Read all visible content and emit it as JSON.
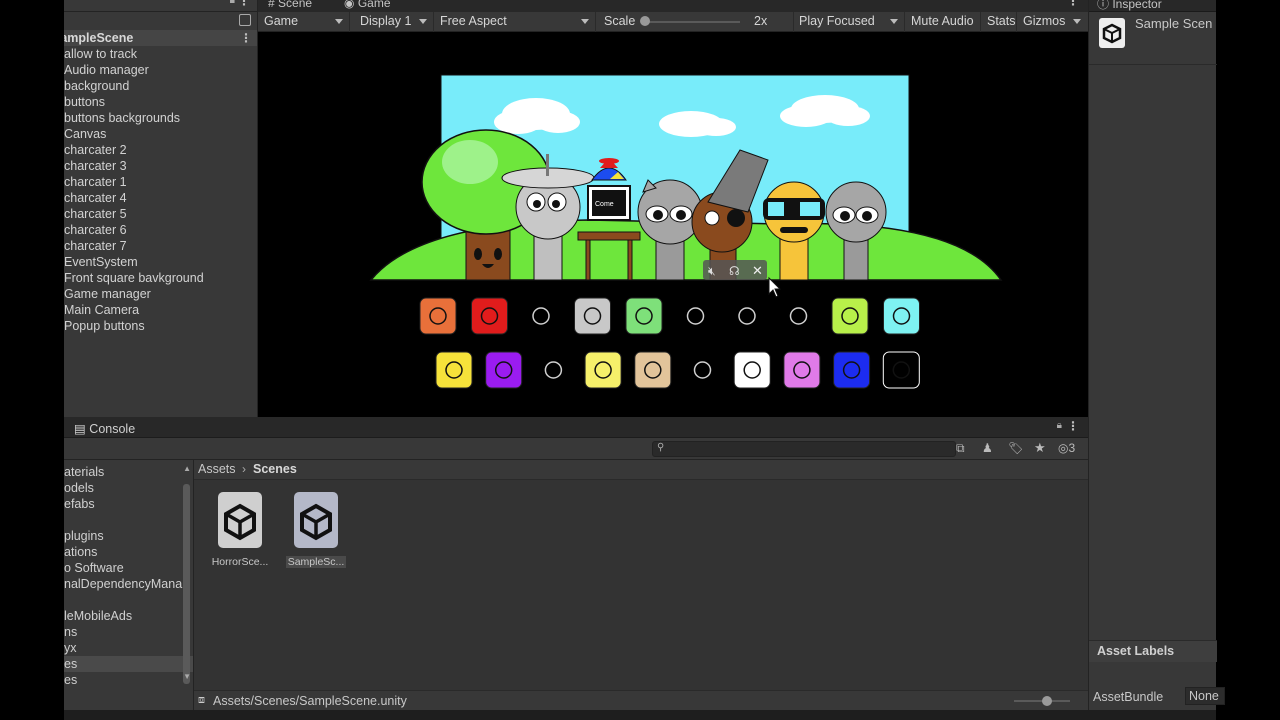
{
  "hierarchy": {
    "scene_name": "SampleScene",
    "items": [
      "allow to track",
      "Audio manager",
      "background",
      "buttons",
      "buttons  backgrounds",
      "Canvas",
      "charcater  2",
      "charcater  3",
      "charcater 1",
      "charcater 4",
      "charcater 5",
      "charcater 6",
      "charcater 7",
      "EventSystem",
      "Front square bavkground",
      "Game manager",
      "Main Camera",
      "Popup buttons"
    ]
  },
  "game": {
    "tabs": {
      "scene": "Scene",
      "game": "Game"
    },
    "toolbar": {
      "mode": "Game",
      "display": "Display 1",
      "aspect": "Free Aspect",
      "scale_label": "Scale",
      "scale_value": "2x",
      "play_mode": "Play Focused",
      "mute": "Mute Audio",
      "stats": "Stats",
      "gizmos": "Gizmos"
    },
    "computer_screen_text": "Come",
    "buttons_row1": [
      "#e8703a",
      "#e01c1c",
      "none",
      "#c8c8c8",
      "#7ee07a",
      "none",
      "none",
      "none",
      "#b8f04a",
      "#7ef2f2"
    ],
    "buttons_row2": [
      "#f6e23a",
      "#9a1cf0",
      "none",
      "#f6f06a",
      "#e2c49a",
      "none",
      "#ffffff",
      "#e07ae8",
      "#1c2cf0",
      "#000000"
    ]
  },
  "inspector": {
    "tab": "Inspector",
    "title": "Sample Scen",
    "asset_labels": "Asset Labels",
    "asset_bundle_label": "AssetBundle",
    "asset_bundle_value": "None"
  },
  "console": {
    "tab": "Console"
  },
  "project": {
    "search_count": "3",
    "breadcrumb_root": "Assets",
    "breadcrumb_current": "Scenes",
    "folders": [
      "aterials",
      "odels",
      "efabs",
      "",
      "plugins",
      "ations",
      "o Software",
      "nalDependencyMana",
      "",
      "leMobileAds",
      "ns",
      "yx",
      "es",
      "es"
    ],
    "assets": [
      {
        "name": "HorrorSce..."
      },
      {
        "name": "SampleSc..."
      }
    ],
    "path": "Assets/Scenes/SampleScene.unity"
  }
}
